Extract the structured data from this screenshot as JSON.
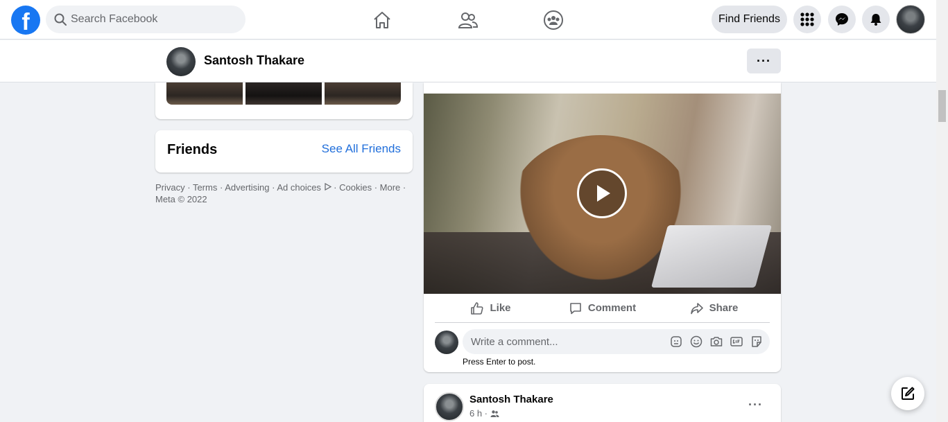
{
  "topbar": {
    "logo": "f",
    "search_placeholder": "Search Facebook",
    "find_friends_label": "Find Friends",
    "icons": [
      "home-icon",
      "friends-icon",
      "groups-icon",
      "menu-grid-icon",
      "messenger-icon",
      "notifications-icon"
    ]
  },
  "profile_bar": {
    "name": "Santosh Thakare",
    "more_label": "···"
  },
  "friends_card": {
    "title": "Friends",
    "see_all": "See All Friends"
  },
  "footer": {
    "links": [
      "Privacy",
      "Terms",
      "Advertising",
      "Ad choices",
      "Cookies",
      "More"
    ],
    "copyright": "Meta © 2022"
  },
  "post": {
    "actions": {
      "like": "Like",
      "comment": "Comment",
      "share": "Share"
    },
    "comment_placeholder": "Write a comment...",
    "press_enter": "Press Enter to post."
  },
  "post2": {
    "author": "Santosh Thakare",
    "time": "6 h ·",
    "more_label": "···"
  },
  "colors": {
    "brand": "#1877f2",
    "link": "#216fdb",
    "background": "#f0f2f5"
  }
}
